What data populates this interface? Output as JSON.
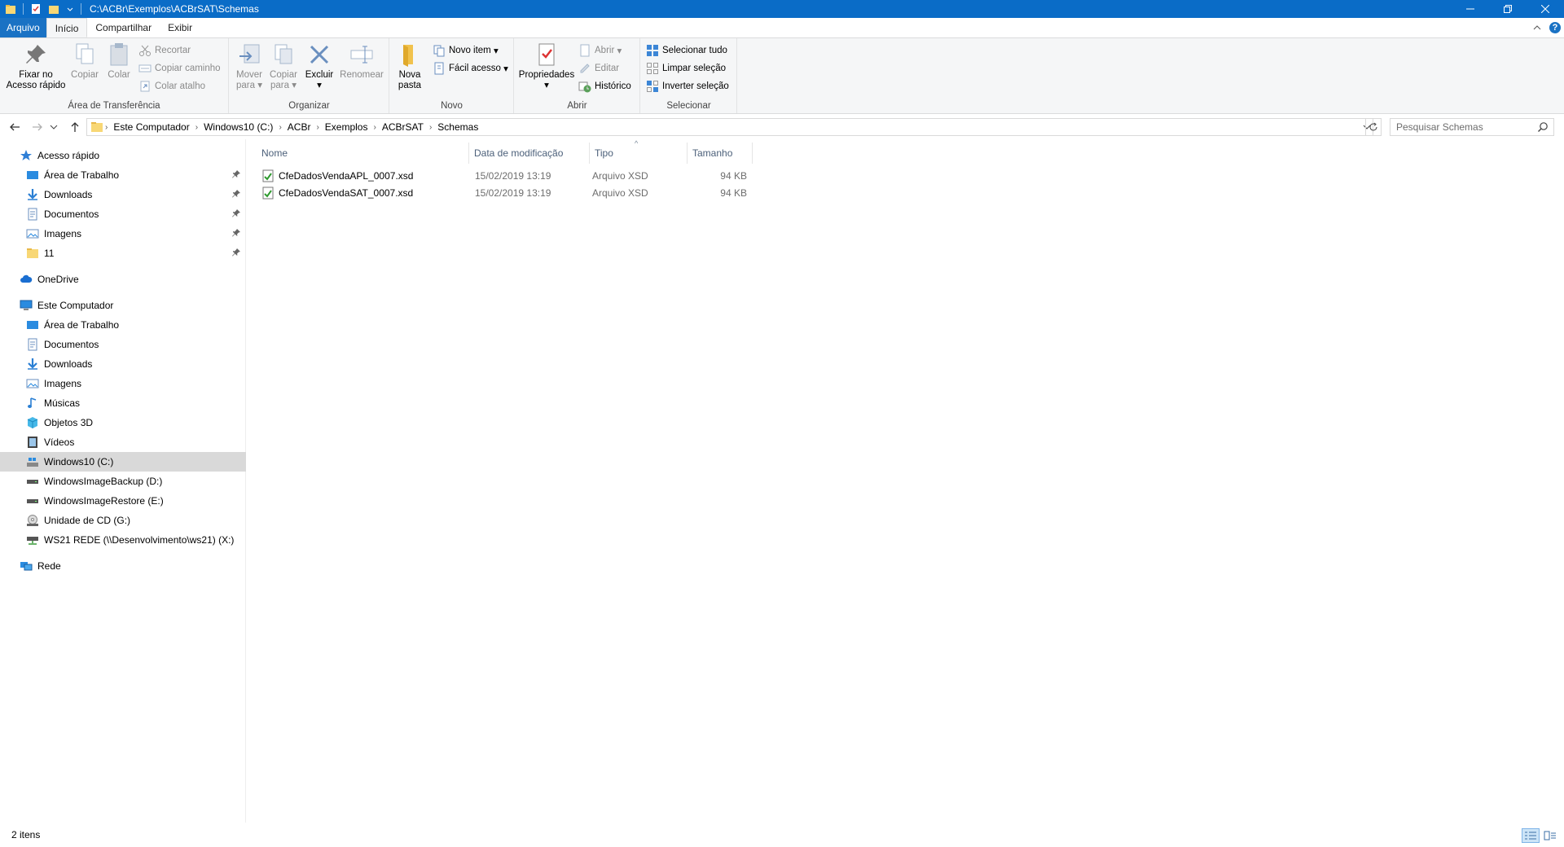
{
  "titlebar": {
    "path": "C:\\ACBr\\Exemplos\\ACBrSAT\\Schemas"
  },
  "ribbon_tabs": [
    "Arquivo",
    "Início",
    "Compartilhar",
    "Exibir"
  ],
  "ribbon": {
    "groups": {
      "clipboard": "Área de Transferência",
      "organize": "Organizar",
      "new": "Novo",
      "open": "Abrir",
      "select": "Selecionar"
    },
    "pin_quick_access": [
      "Fixar no",
      "Acesso rápido"
    ],
    "copy": "Copiar",
    "paste": "Colar",
    "cut": "Recortar",
    "copy_path": "Copiar caminho",
    "paste_shortcut": "Colar atalho",
    "move_to": [
      "Mover",
      "para"
    ],
    "copy_to": [
      "Copiar",
      "para"
    ],
    "delete": "Excluir",
    "rename": "Renomear",
    "new_folder": [
      "Nova",
      "pasta"
    ],
    "new_item": "Novo item",
    "easy_access": "Fácil acesso",
    "properties": "Propriedades",
    "open": "Abrir",
    "edit": "Editar",
    "history": "Histórico",
    "select_all": "Selecionar tudo",
    "select_none": "Limpar seleção",
    "invert_selection": "Inverter seleção"
  },
  "address": {
    "crumbs": [
      "Este Computador",
      "Windows10 (C:)",
      "ACBr",
      "Exemplos",
      "ACBrSAT",
      "Schemas"
    ],
    "search_placeholder": "Pesquisar Schemas"
  },
  "nav_tree": {
    "quick_access": "Acesso rápido",
    "quick_items": [
      "Área de Trabalho",
      "Downloads",
      "Documentos",
      "Imagens",
      "11"
    ],
    "onedrive": "OneDrive",
    "this_pc": "Este Computador",
    "pc_items": [
      "Área de Trabalho",
      "Documentos",
      "Downloads",
      "Imagens",
      "Músicas",
      "Objetos 3D",
      "Vídeos",
      "Windows10 (C:)",
      "WindowsImageBackup (D:)",
      "WindowsImageRestore (E:)",
      "Unidade de CD (G:)",
      "WS21 REDE (\\\\Desenvolvimento\\ws21) (X:)"
    ],
    "network": "Rede"
  },
  "columns": {
    "name": "Nome",
    "date": "Data de modificação",
    "type": "Tipo",
    "size": "Tamanho"
  },
  "files": [
    {
      "name": "CfeDadosVendaAPL_0007.xsd",
      "date": "15/02/2019 13:19",
      "type": "Arquivo XSD",
      "size": "94 KB"
    },
    {
      "name": "CfeDadosVendaSAT_0007.xsd",
      "date": "15/02/2019 13:19",
      "type": "Arquivo XSD",
      "size": "94 KB"
    }
  ],
  "status": {
    "count": "2 itens"
  },
  "colors": {
    "titlebar": "#0a6cc7",
    "file_tab": "#1a72c4",
    "selection": "#d9d9d9"
  }
}
